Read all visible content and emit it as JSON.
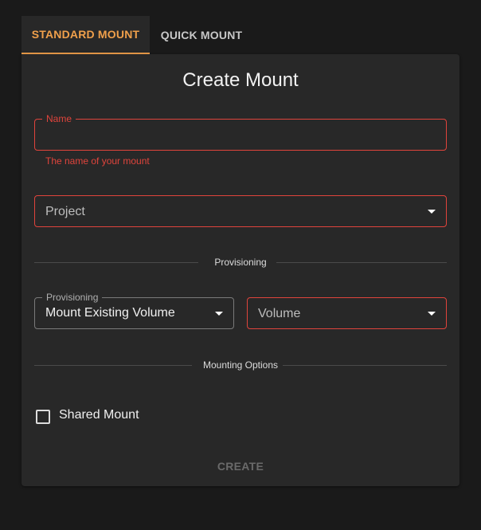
{
  "tabs": [
    {
      "label": "STANDARD MOUNT",
      "active": true
    },
    {
      "label": "QUICK MOUNT",
      "active": false
    }
  ],
  "form": {
    "title": "Create Mount",
    "name_field": {
      "label": "Name",
      "value": "",
      "helper": "The name of your mount"
    },
    "project_select": {
      "placeholder": "Project"
    },
    "provisioning_divider": "Provisioning",
    "provisioning_select": {
      "label": "Provisioning",
      "value": "Mount Existing Volume"
    },
    "volume_select": {
      "placeholder": "Volume"
    },
    "mounting_divider": "Mounting Options",
    "shared_mount": {
      "label": "Shared Mount",
      "checked": false
    },
    "create_button": "CREATE"
  },
  "colors": {
    "accent": "#f0a04b",
    "error": "#e0443c",
    "background": "#1a1a1a",
    "card": "#282828"
  },
  "icons": [
    "caret-down-icon",
    "checkbox-icon"
  ]
}
